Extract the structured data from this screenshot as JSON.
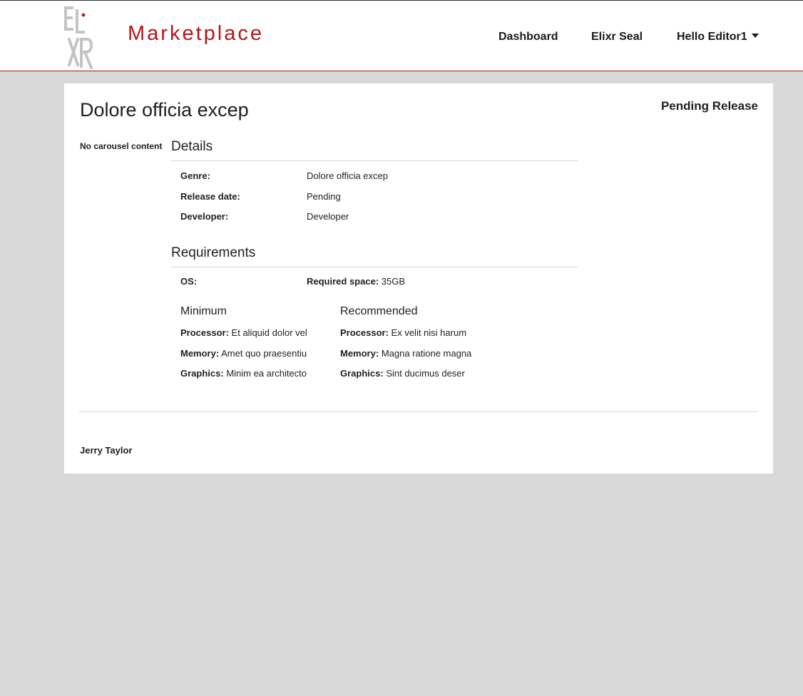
{
  "header": {
    "brand": "Marketplace",
    "logo_icon": "elixr-logo-icon",
    "brand_color": "#b5161b",
    "nav": {
      "dashboard": "Dashboard",
      "seal": "Elixr Seal",
      "user": "Hello Editor1"
    }
  },
  "product": {
    "title": "Dolore officia excep",
    "status": "Pending Release",
    "carousel_empty": "No carousel content"
  },
  "details": {
    "heading": "Details",
    "genre_label": "Genre:",
    "genre_value": "Dolore officia excep",
    "release_label": "Release date:",
    "release_value": "Pending",
    "developer_label": "Developer:",
    "developer_value": "Developer"
  },
  "requirements": {
    "heading": "Requirements",
    "os_label": "OS:",
    "space_label": "Required space:",
    "space_value": "35GB",
    "minimum": {
      "heading": "Minimum",
      "processor_label": "Processor:",
      "processor_value": "Et aliquid dolor vel",
      "memory_label": "Memory:",
      "memory_value": "Amet quo praesentiu",
      "graphics_label": "Graphics:",
      "graphics_value": "Minim ea architecto"
    },
    "recommended": {
      "heading": "Recommended",
      "processor_label": "Processor:",
      "processor_value": "Ex velit nisi harum",
      "memory_label": "Memory:",
      "memory_value": "Magna ratione magna",
      "graphics_label": "Graphics:",
      "graphics_value": "Sint ducimus deser"
    }
  },
  "footer": {
    "author": "Jerry Taylor"
  }
}
